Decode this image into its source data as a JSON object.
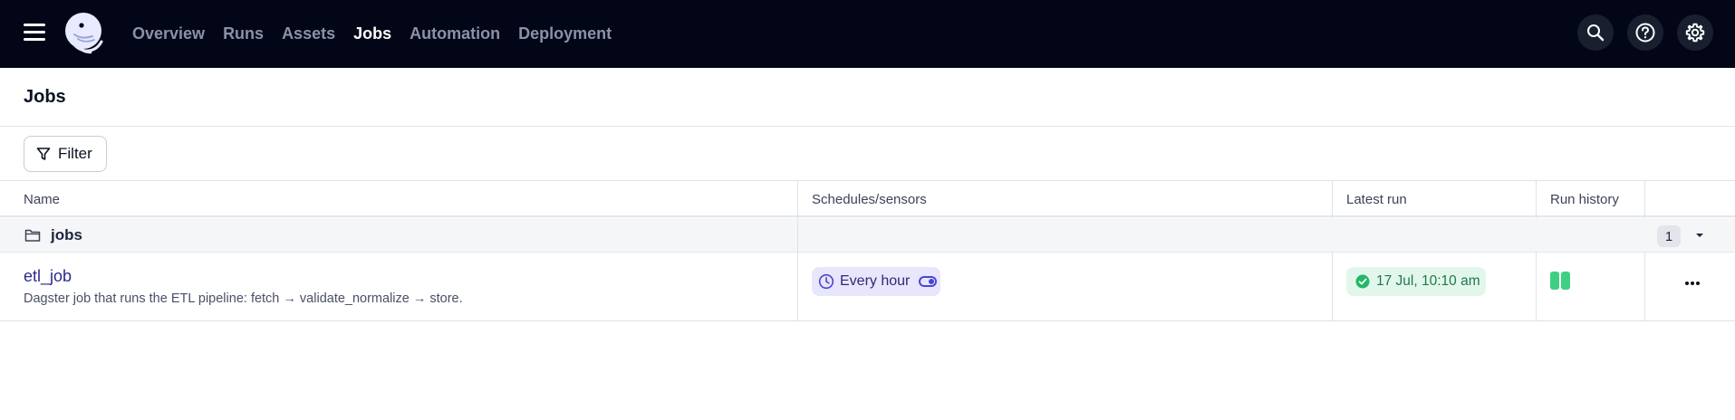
{
  "topbar": {
    "menu_icon": "hamburger-icon",
    "logo_icon": "dagster-logo",
    "nav": [
      {
        "label": "Overview",
        "active": false
      },
      {
        "label": "Runs",
        "active": false
      },
      {
        "label": "Assets",
        "active": false
      },
      {
        "label": "Jobs",
        "active": true
      },
      {
        "label": "Automation",
        "active": false
      },
      {
        "label": "Deployment",
        "active": false
      }
    ],
    "actions": [
      "search-icon",
      "help-icon",
      "gear-icon"
    ]
  },
  "page": {
    "title": "Jobs"
  },
  "filter": {
    "label": "Filter",
    "icon": "filter-icon"
  },
  "table": {
    "columns": [
      "Name",
      "Schedules/sensors",
      "Latest run",
      "Run history"
    ],
    "groups": [
      {
        "name": "jobs",
        "count": "1",
        "icon": "folder-icon",
        "rows": [
          {
            "name": "etl_job",
            "description": "Dagster job that runs the ETL pipeline: fetch → validate_normalize → store.",
            "schedule": {
              "label": "Every hour",
              "icon": "clock-icon",
              "enabled": true
            },
            "latest_run": {
              "label": "17 Jul, 10:10 am",
              "status": "success",
              "icon": "check-circle-icon"
            },
            "run_history": [
              "success",
              "success"
            ]
          }
        ]
      }
    ]
  },
  "colors": {
    "topbar_bg": "#030617",
    "accent_purple": "#4a44d6",
    "success_green": "#3fcf83"
  }
}
